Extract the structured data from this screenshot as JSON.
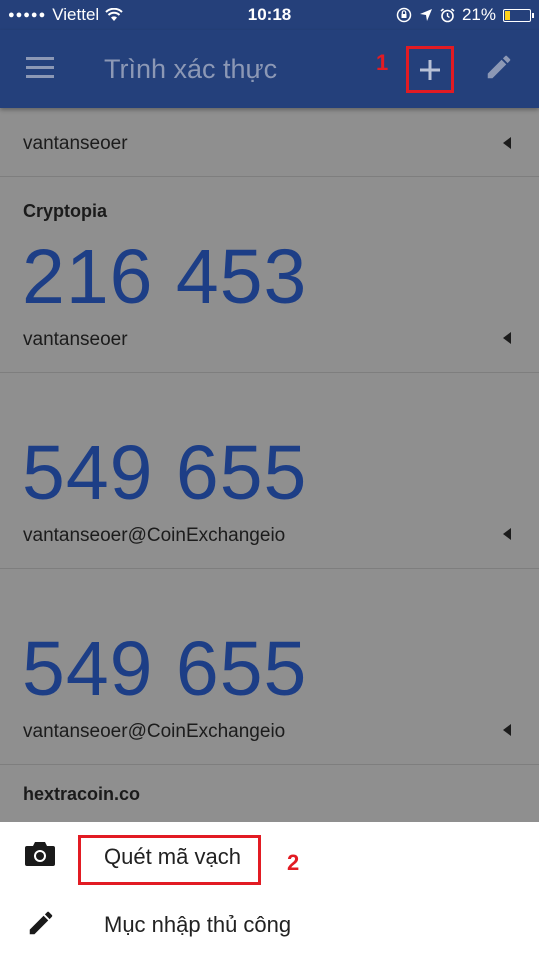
{
  "status": {
    "carrier": "Viettel",
    "time": "10:18",
    "battery": "21%"
  },
  "app_bar": {
    "title": "Trình xác thực",
    "annotation_1": "1"
  },
  "accounts": [
    {
      "issuer": "",
      "code": "",
      "account": "vantanseoer"
    },
    {
      "issuer": "Cryptopia",
      "code": "216 453",
      "account": "vantanseoer"
    },
    {
      "issuer": "",
      "code": "549 655",
      "account": "vantanseoer@CoinExchangeio"
    },
    {
      "issuer": "",
      "code": "549 655",
      "account": "vantanseoer@CoinExchangeio"
    },
    {
      "issuer": "hextracoin.co",
      "code": "",
      "account": ""
    }
  ],
  "sheet": {
    "scan_label": "Quét mã vạch",
    "manual_label": "Mục nhập thủ công",
    "annotation_2": "2"
  },
  "colors": {
    "app_bar": "#24407b",
    "code": "#1d3e86",
    "annotation": "#e21b23",
    "overlay": "#8f8f8f"
  }
}
